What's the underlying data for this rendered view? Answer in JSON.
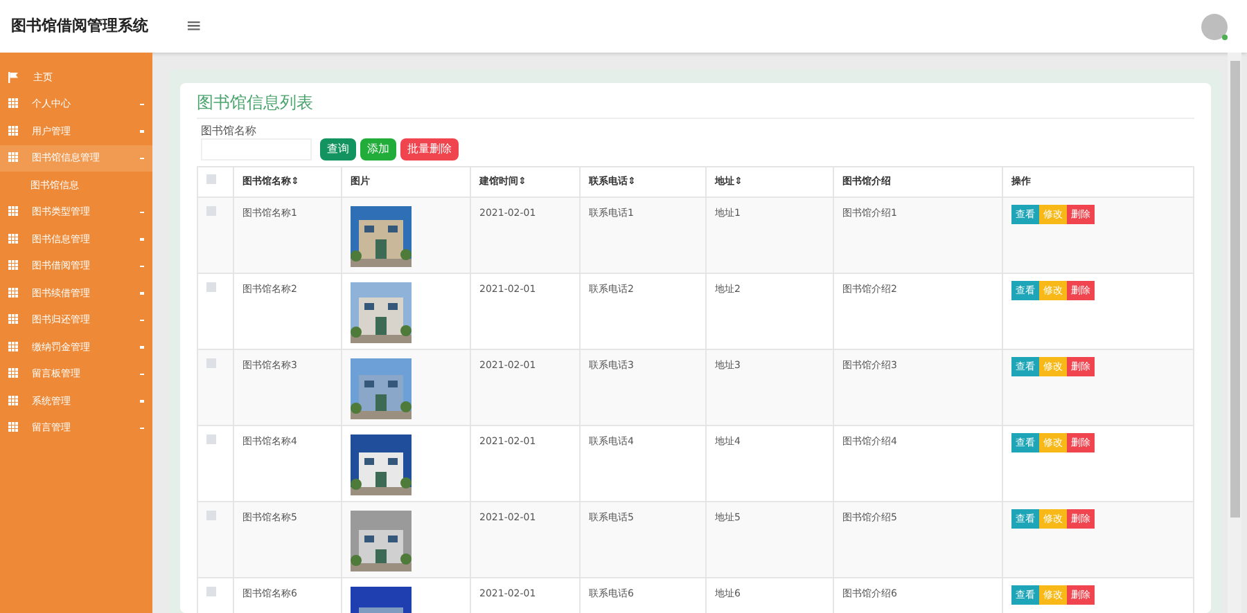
{
  "header": {
    "title": "图书馆借阅管理系统",
    "menu_glyph": "≡"
  },
  "sidebar": {
    "items": [
      {
        "kind": "home",
        "label": "主页",
        "expanded": false
      },
      {
        "kind": "menu",
        "label": "个人中心",
        "expanded": false
      },
      {
        "kind": "menu",
        "label": "用户管理",
        "expanded": false
      },
      {
        "kind": "menu",
        "label": "图书馆信息管理",
        "expanded": true,
        "children": [
          {
            "label": "图书馆信息"
          }
        ]
      },
      {
        "kind": "menu",
        "label": "图书类型管理",
        "expanded": false
      },
      {
        "kind": "menu",
        "label": "图书信息管理",
        "expanded": false
      },
      {
        "kind": "menu",
        "label": "图书借阅管理",
        "expanded": false
      },
      {
        "kind": "menu",
        "label": "图书续借管理",
        "expanded": false
      },
      {
        "kind": "menu",
        "label": "图书归还管理",
        "expanded": false
      },
      {
        "kind": "menu",
        "label": "缴纳罚金管理",
        "expanded": false
      },
      {
        "kind": "menu",
        "label": "留言板管理",
        "expanded": false
      },
      {
        "kind": "menu",
        "label": "系统管理",
        "expanded": false
      },
      {
        "kind": "menu",
        "label": "留言管理",
        "expanded": false
      }
    ]
  },
  "panel": {
    "title": "图书馆信息列表",
    "search_label": "图书馆名称",
    "buttons": [
      {
        "kind": "search",
        "label": "查询"
      },
      {
        "kind": "add",
        "label": "添加"
      },
      {
        "kind": "delete",
        "label": "批量删除"
      }
    ],
    "table": {
      "select_all": {
        "checked": false
      },
      "columns": [
        "图书馆名称⇕",
        "图片",
        "建馆时间⇕",
        "联系电话⇕",
        "地址⇕",
        "图书馆介绍",
        "操作"
      ],
      "rows": [
        {
          "checked": false,
          "name": "图书馆名称1",
          "date": "2021-02-01",
          "phone": "联系电话1",
          "address": "地址1",
          "intro": "图书馆介绍1",
          "actions": [
            "查看",
            "修改",
            "删除"
          ]
        },
        {
          "checked": false,
          "name": "图书馆名称2",
          "date": "2021-02-01",
          "phone": "联系电话2",
          "address": "地址2",
          "intro": "图书馆介绍2",
          "actions": [
            "查看",
            "修改",
            "删除"
          ]
        },
        {
          "checked": false,
          "name": "图书馆名称3",
          "date": "2021-02-01",
          "phone": "联系电话3",
          "address": "地址3",
          "intro": "图书馆介绍3",
          "actions": [
            "查看",
            "修改",
            "删除"
          ]
        },
        {
          "checked": false,
          "name": "图书馆名称4",
          "date": "2021-02-01",
          "phone": "联系电话4",
          "address": "地址4",
          "intro": "图书馆介绍4",
          "actions": [
            "查看",
            "修改",
            "删除"
          ]
        },
        {
          "checked": false,
          "name": "图书馆名称5",
          "date": "2021-02-01",
          "phone": "联系电话5",
          "address": "地址5",
          "intro": "图书馆介绍5",
          "actions": [
            "查看",
            "修改",
            "删除"
          ]
        },
        {
          "checked": false,
          "name": "图书馆名称6",
          "date": "2021-02-01",
          "phone": "联系电话6",
          "address": "地址6",
          "intro": "图书馆介绍6",
          "actions": [
            "查看",
            "修改",
            "删除"
          ]
        }
      ]
    }
  }
}
